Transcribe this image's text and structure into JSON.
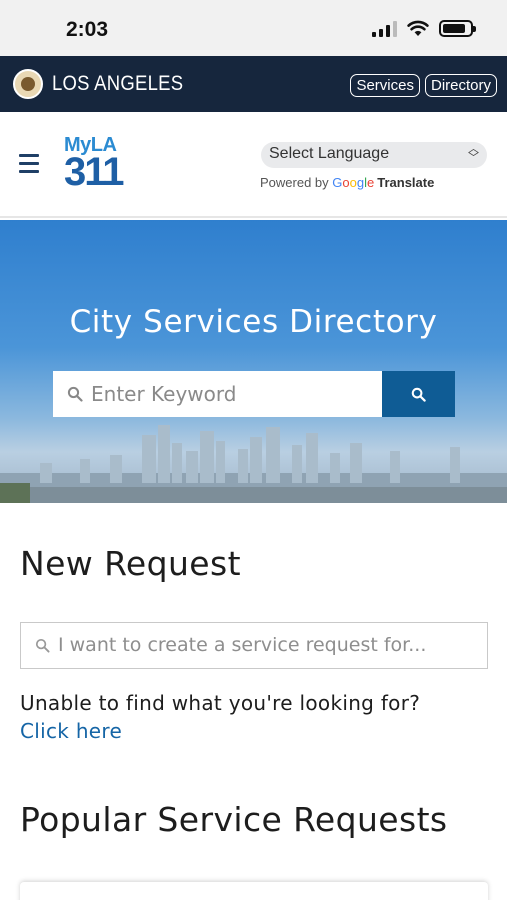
{
  "status_bar": {
    "time": "2:03",
    "icons": [
      "signal-icon",
      "wifi-icon",
      "battery-icon"
    ]
  },
  "top_bar": {
    "seal_icon": "la-city-seal-icon",
    "title": "LOS ANGELES",
    "links": [
      "Services",
      "Directory"
    ]
  },
  "header": {
    "menu_icon": "hamburger-menu-icon",
    "logo": {
      "line1": "MyLA",
      "line2": "311"
    },
    "language_select": {
      "value": "Select Language"
    },
    "powered_by": {
      "prefix": "Powered by",
      "google": "Google",
      "translate": "Translate"
    }
  },
  "hero": {
    "title": "City Services Directory",
    "search": {
      "placeholder": "Enter Keyword",
      "button_icon": "search-icon"
    }
  },
  "new_request": {
    "title": "New Request",
    "input_placeholder": "I want to create a service request for...",
    "help_text": "Unable to find what you're looking for?",
    "help_link": "Click here"
  },
  "popular": {
    "title": "Popular Service Requests"
  },
  "colors": {
    "banner": "#16263d",
    "accent": "#1565a6",
    "search_button": "#0f5c95",
    "logo_light": "#2b8bd2",
    "logo_dark": "#1e5fa5"
  }
}
